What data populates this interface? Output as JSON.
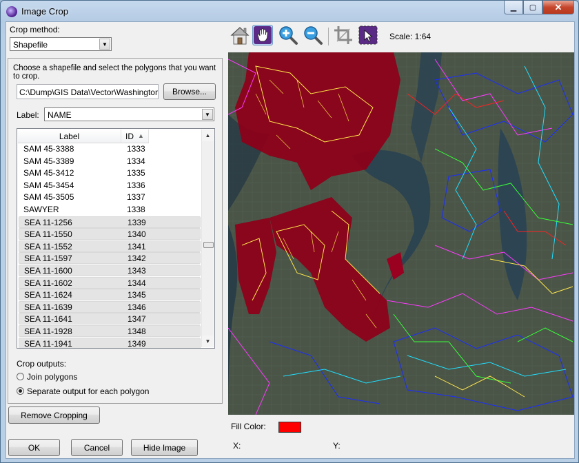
{
  "window": {
    "title": "Image Crop"
  },
  "caption_buttons": {
    "minimize": "▁",
    "maximize": "▢",
    "close": "✕"
  },
  "crop_method": {
    "label": "Crop method:",
    "value": "Shapefile"
  },
  "shapefile": {
    "instructions": "Choose a shapefile and select the polygons that you want to crop.",
    "path": "C:\\Dump\\GIS Data\\Vector\\Washington\\Ki",
    "browse_label": "Browse...",
    "label_field_label": "Label:",
    "label_field_value": "NAME"
  },
  "list": {
    "col_label": "Label",
    "col_id": "ID",
    "rows": [
      {
        "label": "SAM 45-3388",
        "id": "1333",
        "selected": false
      },
      {
        "label": "SAM 45-3389",
        "id": "1334",
        "selected": false
      },
      {
        "label": "SAM 45-3412",
        "id": "1335",
        "selected": false
      },
      {
        "label": "SAM 45-3454",
        "id": "1336",
        "selected": false
      },
      {
        "label": "SAM 45-3505",
        "id": "1337",
        "selected": false
      },
      {
        "label": "SAWYER",
        "id": "1338",
        "selected": false
      },
      {
        "label": "SEA 11-1256",
        "id": "1339",
        "selected": true
      },
      {
        "label": "SEA 11-1550",
        "id": "1340",
        "selected": true
      },
      {
        "label": "SEA 11-1552",
        "id": "1341",
        "selected": true
      },
      {
        "label": "SEA 11-1597",
        "id": "1342",
        "selected": true
      },
      {
        "label": "SEA 11-1600",
        "id": "1343",
        "selected": true
      },
      {
        "label": "SEA 11-1602",
        "id": "1344",
        "selected": true
      },
      {
        "label": "SEA 11-1624",
        "id": "1345",
        "selected": true
      },
      {
        "label": "SEA 11-1639",
        "id": "1346",
        "selected": true
      },
      {
        "label": "SEA 11-1641",
        "id": "1347",
        "selected": true
      },
      {
        "label": "SEA 11-1928",
        "id": "1348",
        "selected": true
      },
      {
        "label": "SEA 11-1941",
        "id": "1349",
        "selected": true
      }
    ]
  },
  "crop_outputs": {
    "label": "Crop outputs:",
    "join_label": "Join polygons",
    "separate_label": "Separate output for each polygon",
    "selected": "separate"
  },
  "buttons": {
    "remove_cropping": "Remove Cropping",
    "ok": "OK",
    "cancel": "Cancel",
    "hide_image": "Hide Image"
  },
  "toolbar": {
    "scale": "Scale: 1:64",
    "icons": [
      "home-icon",
      "pan-hand-icon",
      "zoom-in-icon",
      "zoom-out-icon",
      "crop-icon",
      "select-polygon-icon"
    ],
    "active": "pan-hand-icon"
  },
  "map_footer": {
    "fill_color_label": "Fill Color:",
    "fill_color": "#ff0000",
    "x_label": "X:",
    "y_label": "Y:"
  }
}
